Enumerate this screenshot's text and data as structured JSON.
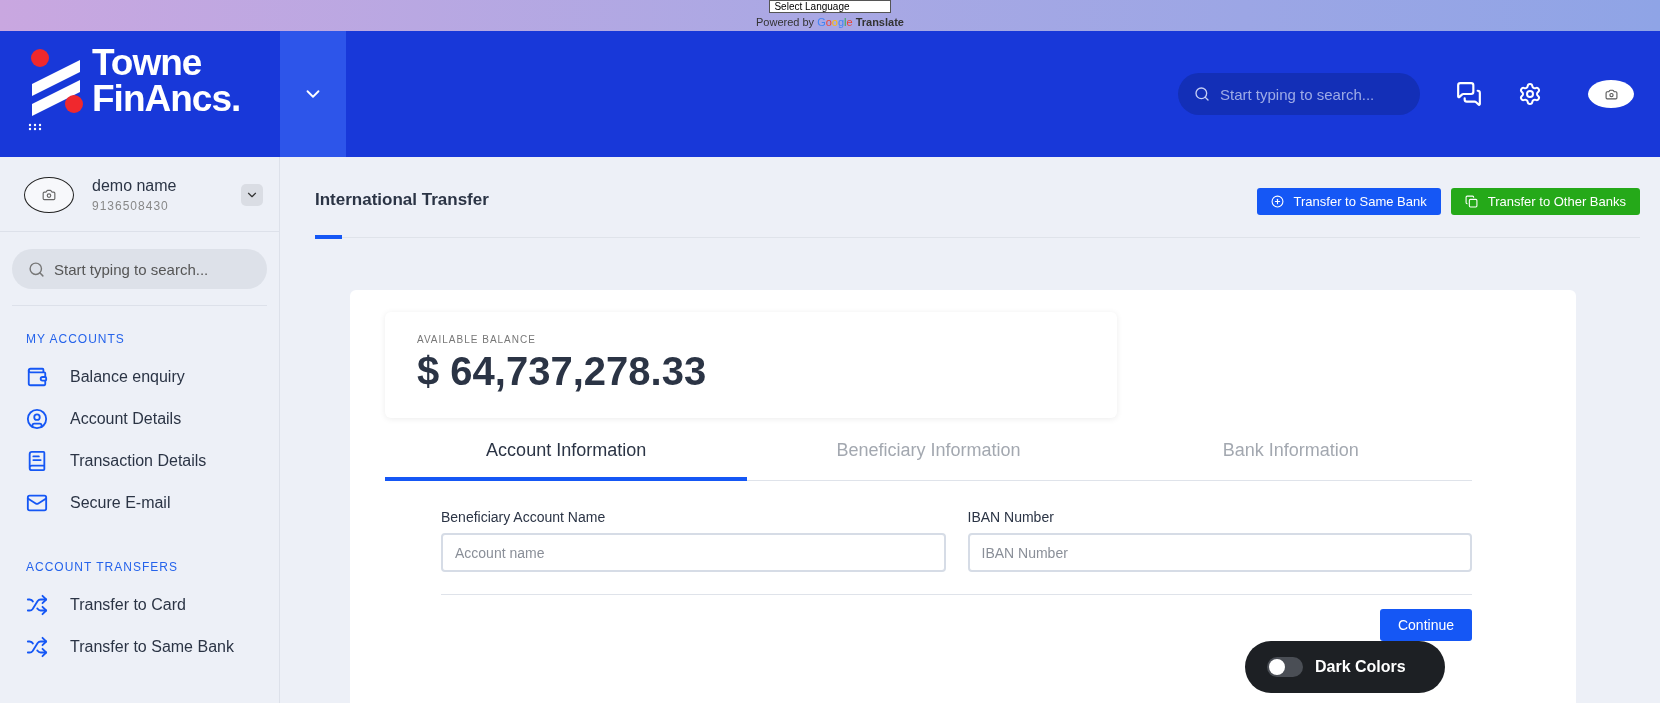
{
  "translate_bar": {
    "select_label": "Select Language",
    "powered_by": "Powered by",
    "brand": "Google",
    "product": "Translate"
  },
  "header": {
    "logo_line_1": "Towne",
    "logo_line_2": "FinAncs.",
    "search_placeholder": "Start typing to search..."
  },
  "user": {
    "name": "demo name",
    "phone": "9136508430"
  },
  "sidebar": {
    "search_placeholder": "Start typing to search...",
    "sections": [
      {
        "heading": "MY ACCOUNTS",
        "items": [
          {
            "label": "Balance enquiry",
            "kind": "wallet"
          },
          {
            "label": "Account Details",
            "kind": "user"
          },
          {
            "label": "Transaction Details",
            "kind": "book"
          },
          {
            "label": "Secure E-mail",
            "kind": "mail"
          }
        ]
      },
      {
        "heading": "ACCOUNT TRANSFERS",
        "items": [
          {
            "label": "Transfer to Card",
            "kind": "shuffle"
          },
          {
            "label": "Transfer to Same Bank",
            "kind": "shuffle"
          }
        ]
      }
    ]
  },
  "page": {
    "title": "International Transfer",
    "actions": [
      {
        "label": "Transfer to Same Bank",
        "kind": "primary"
      },
      {
        "label": "Transfer to Other Banks",
        "kind": "success"
      }
    ]
  },
  "balance": {
    "label": "AVAILABLE BALANCE",
    "amount": "$ 64,737,278.33"
  },
  "tabs": [
    {
      "label": "Account Information",
      "selected": true
    },
    {
      "label": "Beneficiary Information",
      "selected": false
    },
    {
      "label": "Bank Information",
      "selected": false
    }
  ],
  "form": {
    "fields": [
      {
        "label": "Beneficiary Account Name",
        "placeholder": "Account name"
      },
      {
        "label": "IBAN Number",
        "placeholder": "IBAN Number"
      }
    ],
    "submit": "Continue"
  },
  "theme_toggle": {
    "label": "Dark Colors",
    "on": false
  }
}
